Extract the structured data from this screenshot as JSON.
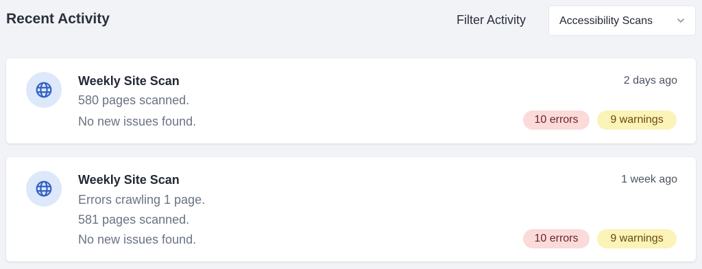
{
  "header": {
    "title": "Recent Activity",
    "filter_label": "Filter Activity",
    "filter_value": "Accessibility Scans"
  },
  "colors": {
    "background": "#f1f3f7",
    "icon_bg": "#dde8fb",
    "icon_color": "#2f5fc4",
    "error_badge_bg": "#fbdada",
    "warning_badge_bg": "#fbf3b8"
  },
  "activities": [
    {
      "icon": "globe-icon",
      "title": "Weekly Site Scan",
      "lines": [
        "580 pages scanned.",
        "No new issues found."
      ],
      "timestamp": "2 days ago",
      "errors": "10 errors",
      "warnings": "9 warnings"
    },
    {
      "icon": "globe-icon",
      "title": "Weekly Site Scan",
      "lines": [
        "Errors crawling 1 page.",
        "581 pages scanned.",
        "No new issues found."
      ],
      "timestamp": "1 week ago",
      "errors": "10 errors",
      "warnings": "9 warnings"
    }
  ]
}
